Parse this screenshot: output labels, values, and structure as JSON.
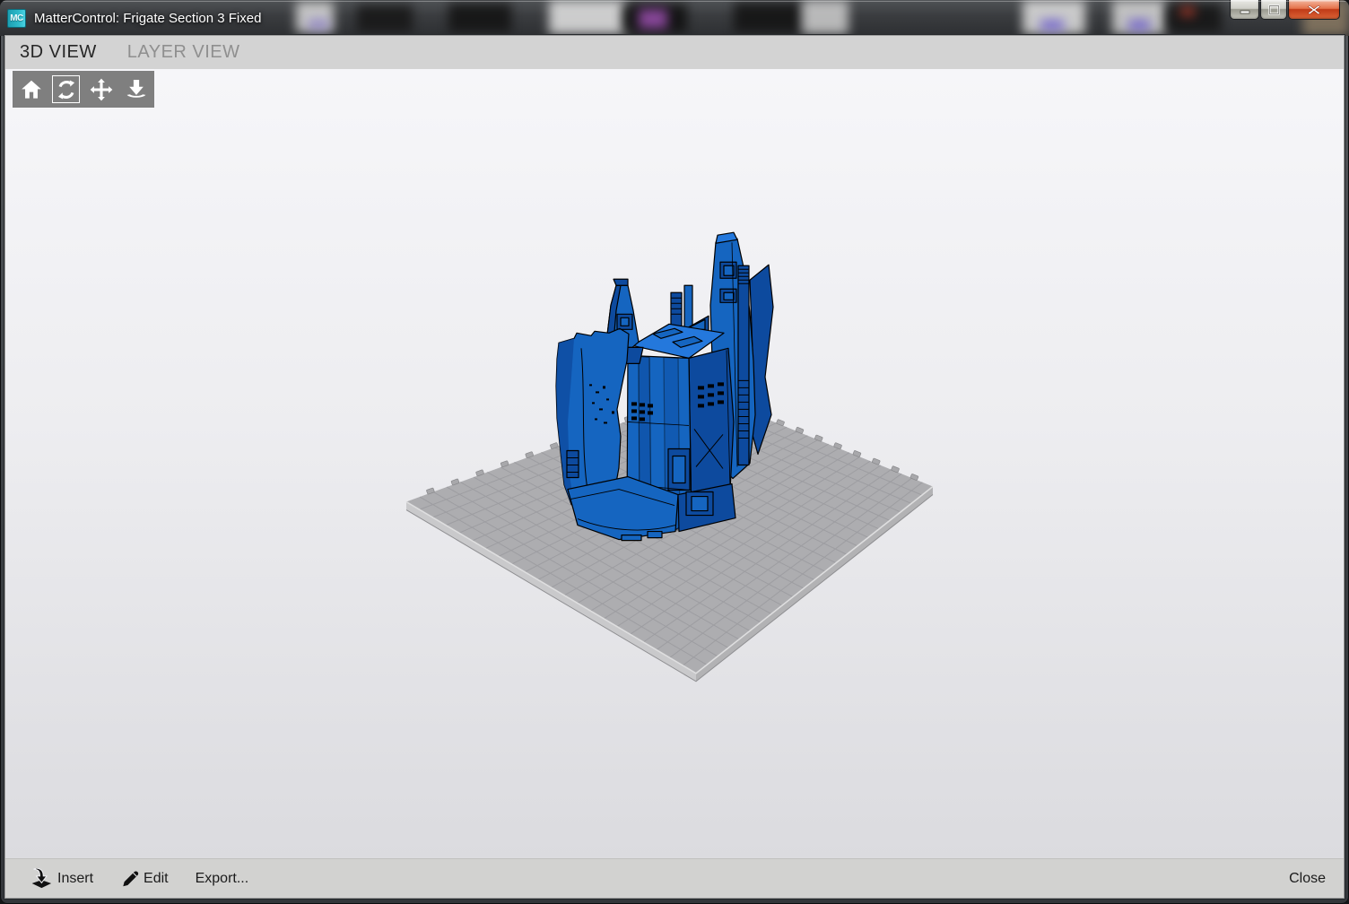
{
  "window": {
    "title": "MatterControl: Frigate Section 3 Fixed",
    "app_icon": {
      "name": "mattercontrol-logo",
      "text": "MC",
      "color": "#2db9c9"
    },
    "controls": [
      {
        "name": "minimize"
      },
      {
        "name": "maximize"
      },
      {
        "name": "close"
      }
    ]
  },
  "tabs": [
    {
      "label": "3D VIEW",
      "active": true
    },
    {
      "label": "LAYER VIEW",
      "active": false
    }
  ],
  "toolbar": {
    "active_tool": "rotate",
    "tools": [
      {
        "name": "home",
        "icon": "home-icon"
      },
      {
        "name": "rotate",
        "icon": "rotate-icon"
      },
      {
        "name": "move",
        "icon": "move-arrows-icon"
      },
      {
        "name": "drop-to-bed",
        "icon": "drop-arrow-icon"
      }
    ]
  },
  "scene": {
    "model_color": "#1565C0",
    "model_color_dark": "#0D4A9E",
    "model_color_light": "#2478DC",
    "platform_color": "#ADADB0",
    "platform_grid_color": "#9D9DA1",
    "platform_side_light": "#C9C9CB",
    "platform_side_dark": "#B2B2B4"
  },
  "bottom_bar": {
    "items": [
      {
        "label": "Insert",
        "icon": "insert-arrow-icon"
      },
      {
        "label": "Edit",
        "icon": "edit-pencil-icon"
      },
      {
        "label": "Export...",
        "icon": ""
      }
    ],
    "close_label": "Close"
  }
}
